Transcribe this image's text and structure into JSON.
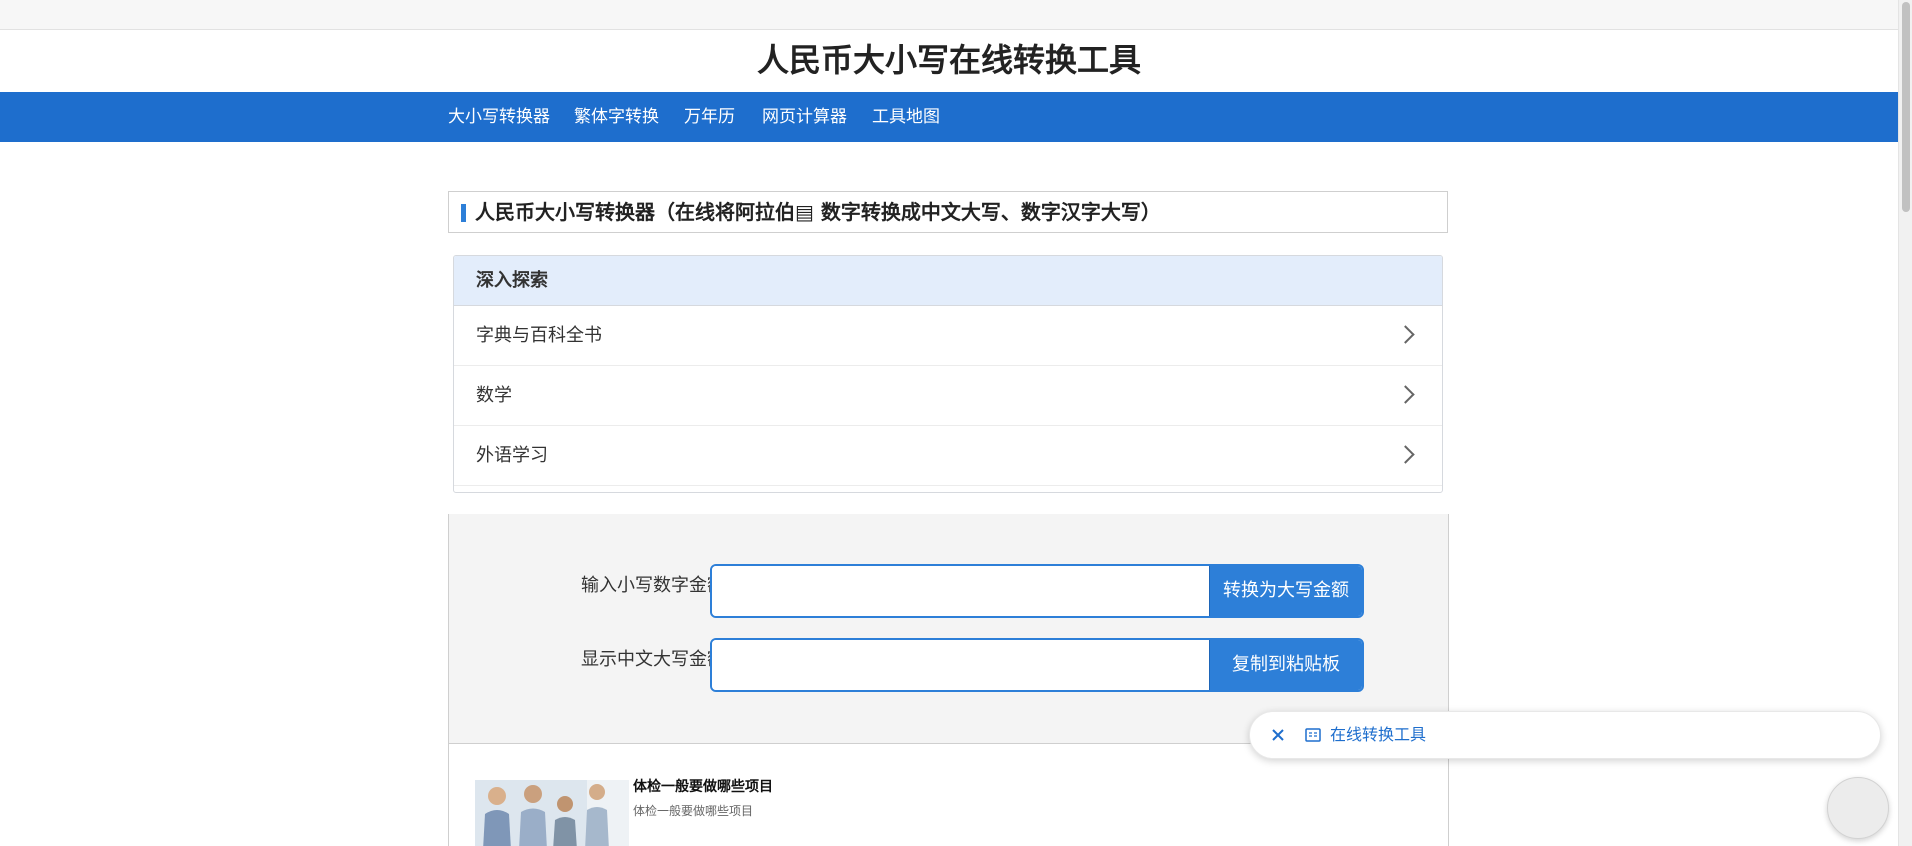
{
  "site": {
    "title": "人民币大小写在线转换工具"
  },
  "nav": {
    "items": [
      {
        "label": "大小写转换器"
      },
      {
        "label": "繁体字转换"
      },
      {
        "label": "万年历"
      },
      {
        "label": "网页计算器"
      },
      {
        "label": "工具地图"
      }
    ]
  },
  "page": {
    "heading": "人民币大小写转换器（在线将阿拉伯▤ 数字转换成中文大写、数字汉字大写）"
  },
  "explore": {
    "title": "深入探索",
    "items": [
      {
        "label": "字典与百科全书"
      },
      {
        "label": "数学"
      },
      {
        "label": "外语学习"
      }
    ]
  },
  "converter": {
    "input_label": "输入小写数字金额：",
    "input_value": "",
    "convert_button": "转换为大写金额",
    "output_label": "显示中文大写金额：",
    "output_value": "",
    "copy_button": "复制到粘贴板"
  },
  "article": {
    "title": "体检一般要做哪些项目",
    "subtitle": "体检一般要做哪些项目"
  },
  "floating_bar": {
    "link_label": "在线转换工具"
  },
  "colors": {
    "brand_blue": "#1e6ecd",
    "button_blue": "#2d7fd8",
    "explore_header": "#e3edfb"
  },
  "icons": [
    "close-icon",
    "tool-icon",
    "chevron-right-icon"
  ]
}
